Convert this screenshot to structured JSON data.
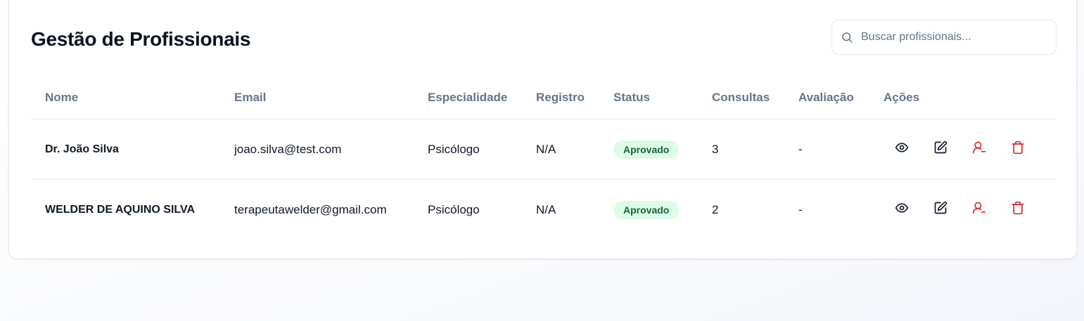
{
  "page": {
    "title": "Gestão de Profissionais"
  },
  "search": {
    "placeholder": "Buscar profissionais...",
    "value": "",
    "icon": "search-icon"
  },
  "table": {
    "columns": [
      "Nome",
      "Email",
      "Especialidade",
      "Registro",
      "Status",
      "Consultas",
      "Avaliação",
      "Ações"
    ],
    "rows": [
      {
        "nome": "Dr. João Silva",
        "email": "joao.silva@test.com",
        "especialidade": "Psicólogo",
        "registro": "N/A",
        "status": "Aprovado",
        "consultas": "3",
        "avaliacao": "-"
      },
      {
        "nome": "WELDER DE AQUINO SILVA",
        "email": "terapeutawelder@gmail.com",
        "especialidade": "Psicólogo",
        "registro": "N/A",
        "status": "Aprovado",
        "consultas": "2",
        "avaliacao": "-"
      }
    ],
    "actions": [
      "eye-icon",
      "edit-icon",
      "user-minus-icon",
      "trash-icon"
    ]
  },
  "colors": {
    "status_approved_bg": "#dcfce7",
    "status_approved_text": "#166534",
    "danger": "#dc2626",
    "muted_text": "#64748b"
  }
}
